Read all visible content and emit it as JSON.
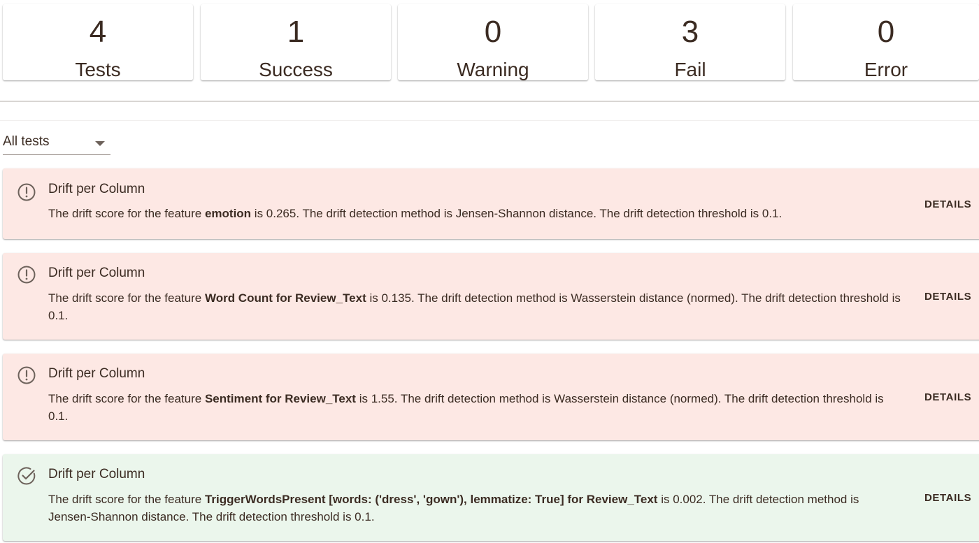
{
  "summary": [
    {
      "count": "4",
      "label": "Tests"
    },
    {
      "count": "1",
      "label": "Success"
    },
    {
      "count": "0",
      "label": "Warning"
    },
    {
      "count": "3",
      "label": "Fail"
    },
    {
      "count": "0",
      "label": "Error"
    }
  ],
  "filter": {
    "selected": "All tests"
  },
  "colors": {
    "fail_bg": "#fde8e4",
    "success_bg": "#ebf6ec",
    "text": "#3b2b22"
  },
  "tests": [
    {
      "status": "fail",
      "icon": "exclamation-circle-icon",
      "title": "Drift per Column",
      "desc_prefix": "The drift score for the feature ",
      "feature": "emotion",
      "desc_suffix": " is 0.265. The drift detection method is Jensen-Shannon distance. The drift detection threshold is 0.1.",
      "details_label": "DETAILS"
    },
    {
      "status": "fail",
      "icon": "exclamation-circle-icon",
      "title": "Drift per Column",
      "desc_prefix": "The drift score for the feature ",
      "feature": "Word Count for Review_Text",
      "desc_suffix": " is 0.135. The drift detection method is Wasserstein distance (normed). The drift detection threshold is 0.1.",
      "details_label": "DETAILS"
    },
    {
      "status": "fail",
      "icon": "exclamation-circle-icon",
      "title": "Drift per Column",
      "desc_prefix": "The drift score for the feature ",
      "feature": "Sentiment for Review_Text",
      "desc_suffix": " is 1.55. The drift detection method is Wasserstein distance (normed). The drift detection threshold is 0.1.",
      "details_label": "DETAILS"
    },
    {
      "status": "success",
      "icon": "check-circle-icon",
      "title": "Drift per Column",
      "desc_prefix": "The drift score for the feature ",
      "feature": "TriggerWordsPresent [words: ('dress', 'gown'), lemmatize: True] for Review_Text",
      "desc_suffix": " is 0.002. The drift detection method is Jensen-Shannon distance. The drift detection threshold is 0.1.",
      "details_label": "DETAILS"
    }
  ]
}
